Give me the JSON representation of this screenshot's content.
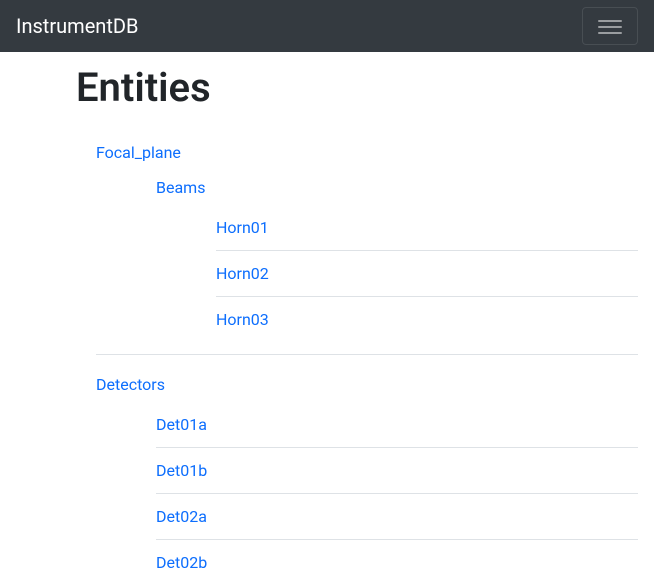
{
  "navbar": {
    "brand": "InstrumentDB"
  },
  "page": {
    "title": "Entities"
  },
  "tree": [
    {
      "label": "Focal_plane",
      "children": [
        {
          "label": "Beams",
          "children": [
            {
              "label": "Horn01"
            },
            {
              "label": "Horn02"
            },
            {
              "label": "Horn03"
            }
          ]
        }
      ]
    },
    {
      "label": "Detectors",
      "children": [
        {
          "label": "Det01a"
        },
        {
          "label": "Det01b"
        },
        {
          "label": "Det02a"
        },
        {
          "label": "Det02b"
        }
      ]
    }
  ]
}
